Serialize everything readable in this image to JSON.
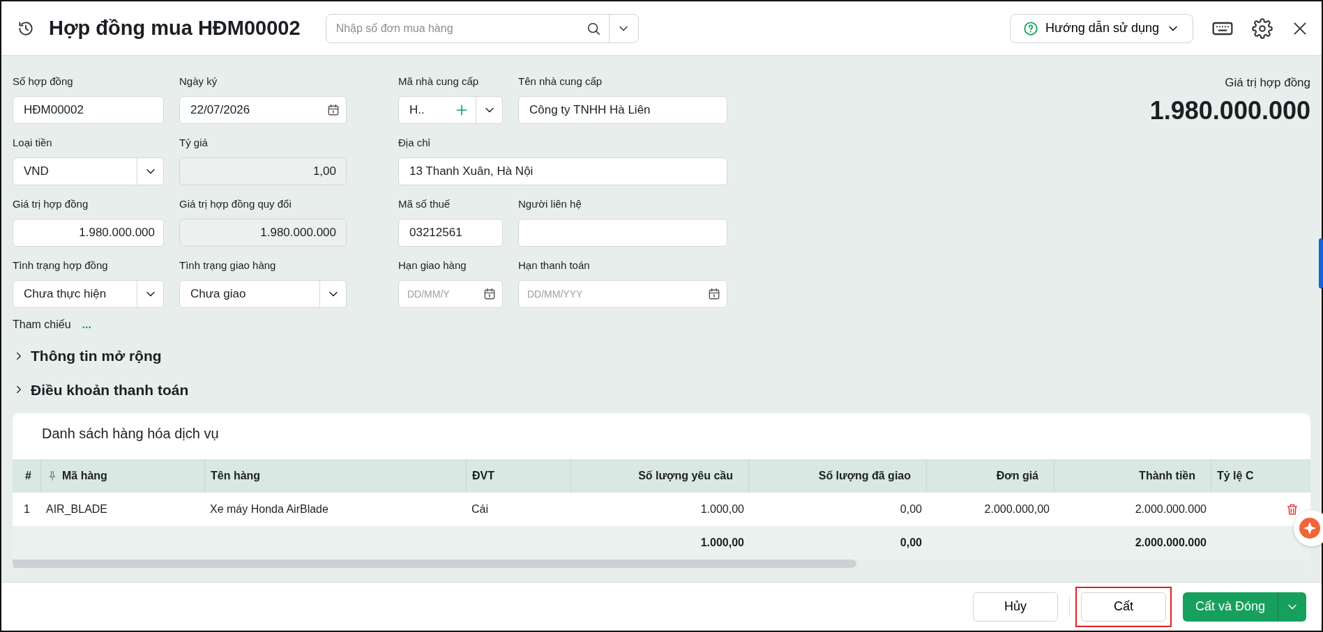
{
  "header": {
    "title": "Hợp đồng mua HĐM00002",
    "search": {
      "placeholder": "Nhập số đơn mua hàng"
    },
    "help_button": "Hướng dẫn sử dụng"
  },
  "form_rows": [
    {
      "fields": [
        {
          "kind": "text",
          "label": "Số hợp đồng",
          "value": "HĐM00002"
        },
        {
          "kind": "date",
          "label": "Ngày ký",
          "value": "22/07/2026"
        },
        {
          "kind": "code-picker",
          "label": "Mã nhà cung cấp",
          "value": "H.."
        },
        {
          "kind": "text",
          "label": "Tên nhà cung cấp",
          "value": "Công ty TNHH Hà Liên"
        }
      ]
    },
    {
      "fields": [
        {
          "kind": "select",
          "label": "Loại tiền",
          "value": "VND"
        },
        {
          "kind": "readonly",
          "label": "Tỷ giá",
          "value": "1,00"
        },
        {
          "kind": "text",
          "label": "Địa chỉ",
          "value": "13 Thanh Xuân, Hà Nội"
        }
      ]
    },
    {
      "fields": [
        {
          "kind": "number",
          "label": "Giá trị hợp đồng",
          "value": "1.980.000.000"
        },
        {
          "kind": "readonly",
          "label": "Giá trị hợp đồng quy đổi",
          "value": "1.980.000.000"
        },
        {
          "kind": "text",
          "label": "Mã số thuế",
          "value": "03212561"
        },
        {
          "kind": "text",
          "label": "Người liên hệ"
        }
      ]
    },
    {
      "fields": [
        {
          "kind": "select",
          "label": "Tình trạng hợp đồng",
          "value": "Chưa thực hiện"
        },
        {
          "kind": "select",
          "label": "Tình trạng giao hàng",
          "value": "Chưa giao"
        },
        {
          "kind": "date",
          "label": "Hạn giao hàng",
          "placeholder": "DD/MM/Y"
        },
        {
          "kind": "date",
          "label": "Hạn thanh toán",
          "placeholder": "DD/MM/YYY"
        }
      ]
    }
  ],
  "reference": {
    "label": "Tham chiếu",
    "link": "..."
  },
  "sections": [
    {
      "title": "Thông tin mở rộng",
      "expanded": false
    },
    {
      "title": "Điều khoản thanh toán",
      "expanded": false
    }
  ],
  "contract_value": {
    "label": "Giá trị hợp đồng",
    "value": "1.980.000.000"
  },
  "table": {
    "title": "Danh sách hàng hóa dịch vụ",
    "columns": [
      {
        "label": "#",
        "kind": "text"
      },
      {
        "label": "Mã hàng",
        "kind": "text",
        "pinned": true
      },
      {
        "label": "Tên hàng",
        "kind": "text"
      },
      {
        "label": "ĐVT",
        "kind": "text"
      },
      {
        "label": "Số lượng yêu cầu",
        "kind": "number"
      },
      {
        "label": "Số lượng đã giao",
        "kind": "number"
      },
      {
        "label": "Đơn giá",
        "kind": "number"
      },
      {
        "label": "Thành tiền",
        "kind": "number"
      },
      {
        "label": "Tỷ lệ C",
        "kind": "text"
      }
    ],
    "rows": [
      {
        "cells": [
          "1",
          "AIR_BLADE",
          "Xe máy Honda AirBlade",
          "Cái",
          "1.000,00",
          "0,00",
          "2.000.000,00",
          "2.000.000.000"
        ]
      }
    ],
    "totals": {
      "requested_quantity": "1.000,00",
      "delivered_quantity": "0,00",
      "amount": "2.000.000.000"
    }
  },
  "footer": {
    "buttons": [
      {
        "kind": "plain",
        "label": "Hủy",
        "highlighted": false
      },
      {
        "kind": "plain",
        "label": "Cất",
        "highlighted": true
      },
      {
        "kind": "primary-split",
        "label": "Cất và Đóng",
        "highlighted": false
      }
    ]
  }
}
